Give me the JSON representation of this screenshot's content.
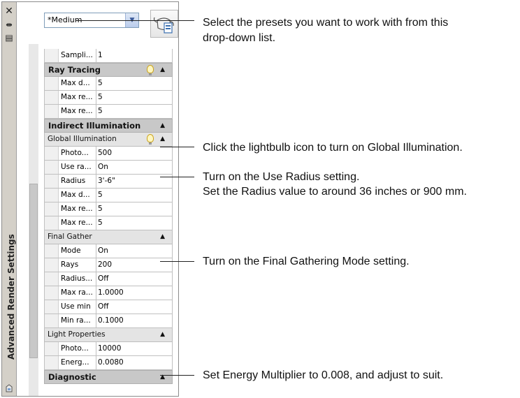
{
  "palette": {
    "title": "Advanced Render Settings",
    "close_glyph": "✕",
    "autohide_glyph": "⇹",
    "properties_glyph": "▤"
  },
  "preset": {
    "selected": "*Medium"
  },
  "grid": {
    "rows": [
      {
        "type": "prop",
        "name": "Sampli...",
        "value": "1"
      },
      {
        "type": "section",
        "label": "Ray Tracing",
        "bulb": true
      },
      {
        "type": "prop",
        "name": "Max d...",
        "value": "5"
      },
      {
        "type": "prop",
        "name": "Max re...",
        "value": "5"
      },
      {
        "type": "prop",
        "name": "Max re...",
        "value": "5"
      },
      {
        "type": "section",
        "label": "Indirect Illumination",
        "bulb": false
      },
      {
        "type": "sub",
        "label": "Global Illumination",
        "bulb": true
      },
      {
        "type": "prop",
        "name": "Photo...",
        "value": "500"
      },
      {
        "type": "prop",
        "name": "Use ra...",
        "value": "On"
      },
      {
        "type": "prop",
        "name": "Radius",
        "value": "3'-6\""
      },
      {
        "type": "prop",
        "name": "Max d...",
        "value": "5"
      },
      {
        "type": "prop",
        "name": "Max re...",
        "value": "5"
      },
      {
        "type": "prop",
        "name": "Max re...",
        "value": "5"
      },
      {
        "type": "sub",
        "label": "Final Gather",
        "bulb": false
      },
      {
        "type": "prop",
        "name": "Mode",
        "value": "On"
      },
      {
        "type": "prop",
        "name": "Rays",
        "value": "200"
      },
      {
        "type": "prop",
        "name": "Radius...",
        "value": "Off"
      },
      {
        "type": "prop",
        "name": "Max ra...",
        "value": "1.0000"
      },
      {
        "type": "prop",
        "name": "Use min",
        "value": "Off"
      },
      {
        "type": "prop",
        "name": "Min ra...",
        "value": "0.1000"
      },
      {
        "type": "sub",
        "label": "Light Properties",
        "bulb": false
      },
      {
        "type": "prop",
        "name": "Photo...",
        "value": "10000"
      },
      {
        "type": "prop",
        "name": "Energ...",
        "value": "0.0080"
      },
      {
        "type": "section",
        "label": "Diagnostic",
        "bulb": false
      }
    ]
  },
  "callouts": {
    "presets_line1": "Select the presets you want to work with from this",
    "presets_line2": "drop-down list.",
    "lightbulb": "Click the lightbulb icon to turn on Global Illumination.",
    "radius_line1": "Turn on the Use Radius setting.",
    "radius_line2": "Set the Radius value to around 36 inches or 900 mm.",
    "final_gather": "Turn on the Final Gathering Mode setting.",
    "energy": "Set Energy Multiplier to 0.008, and adjust to suit."
  },
  "colors": {
    "section_bg": "#c8c8c8",
    "subsection_bg": "#e4e4e4",
    "bulb": "#fff7c0"
  }
}
